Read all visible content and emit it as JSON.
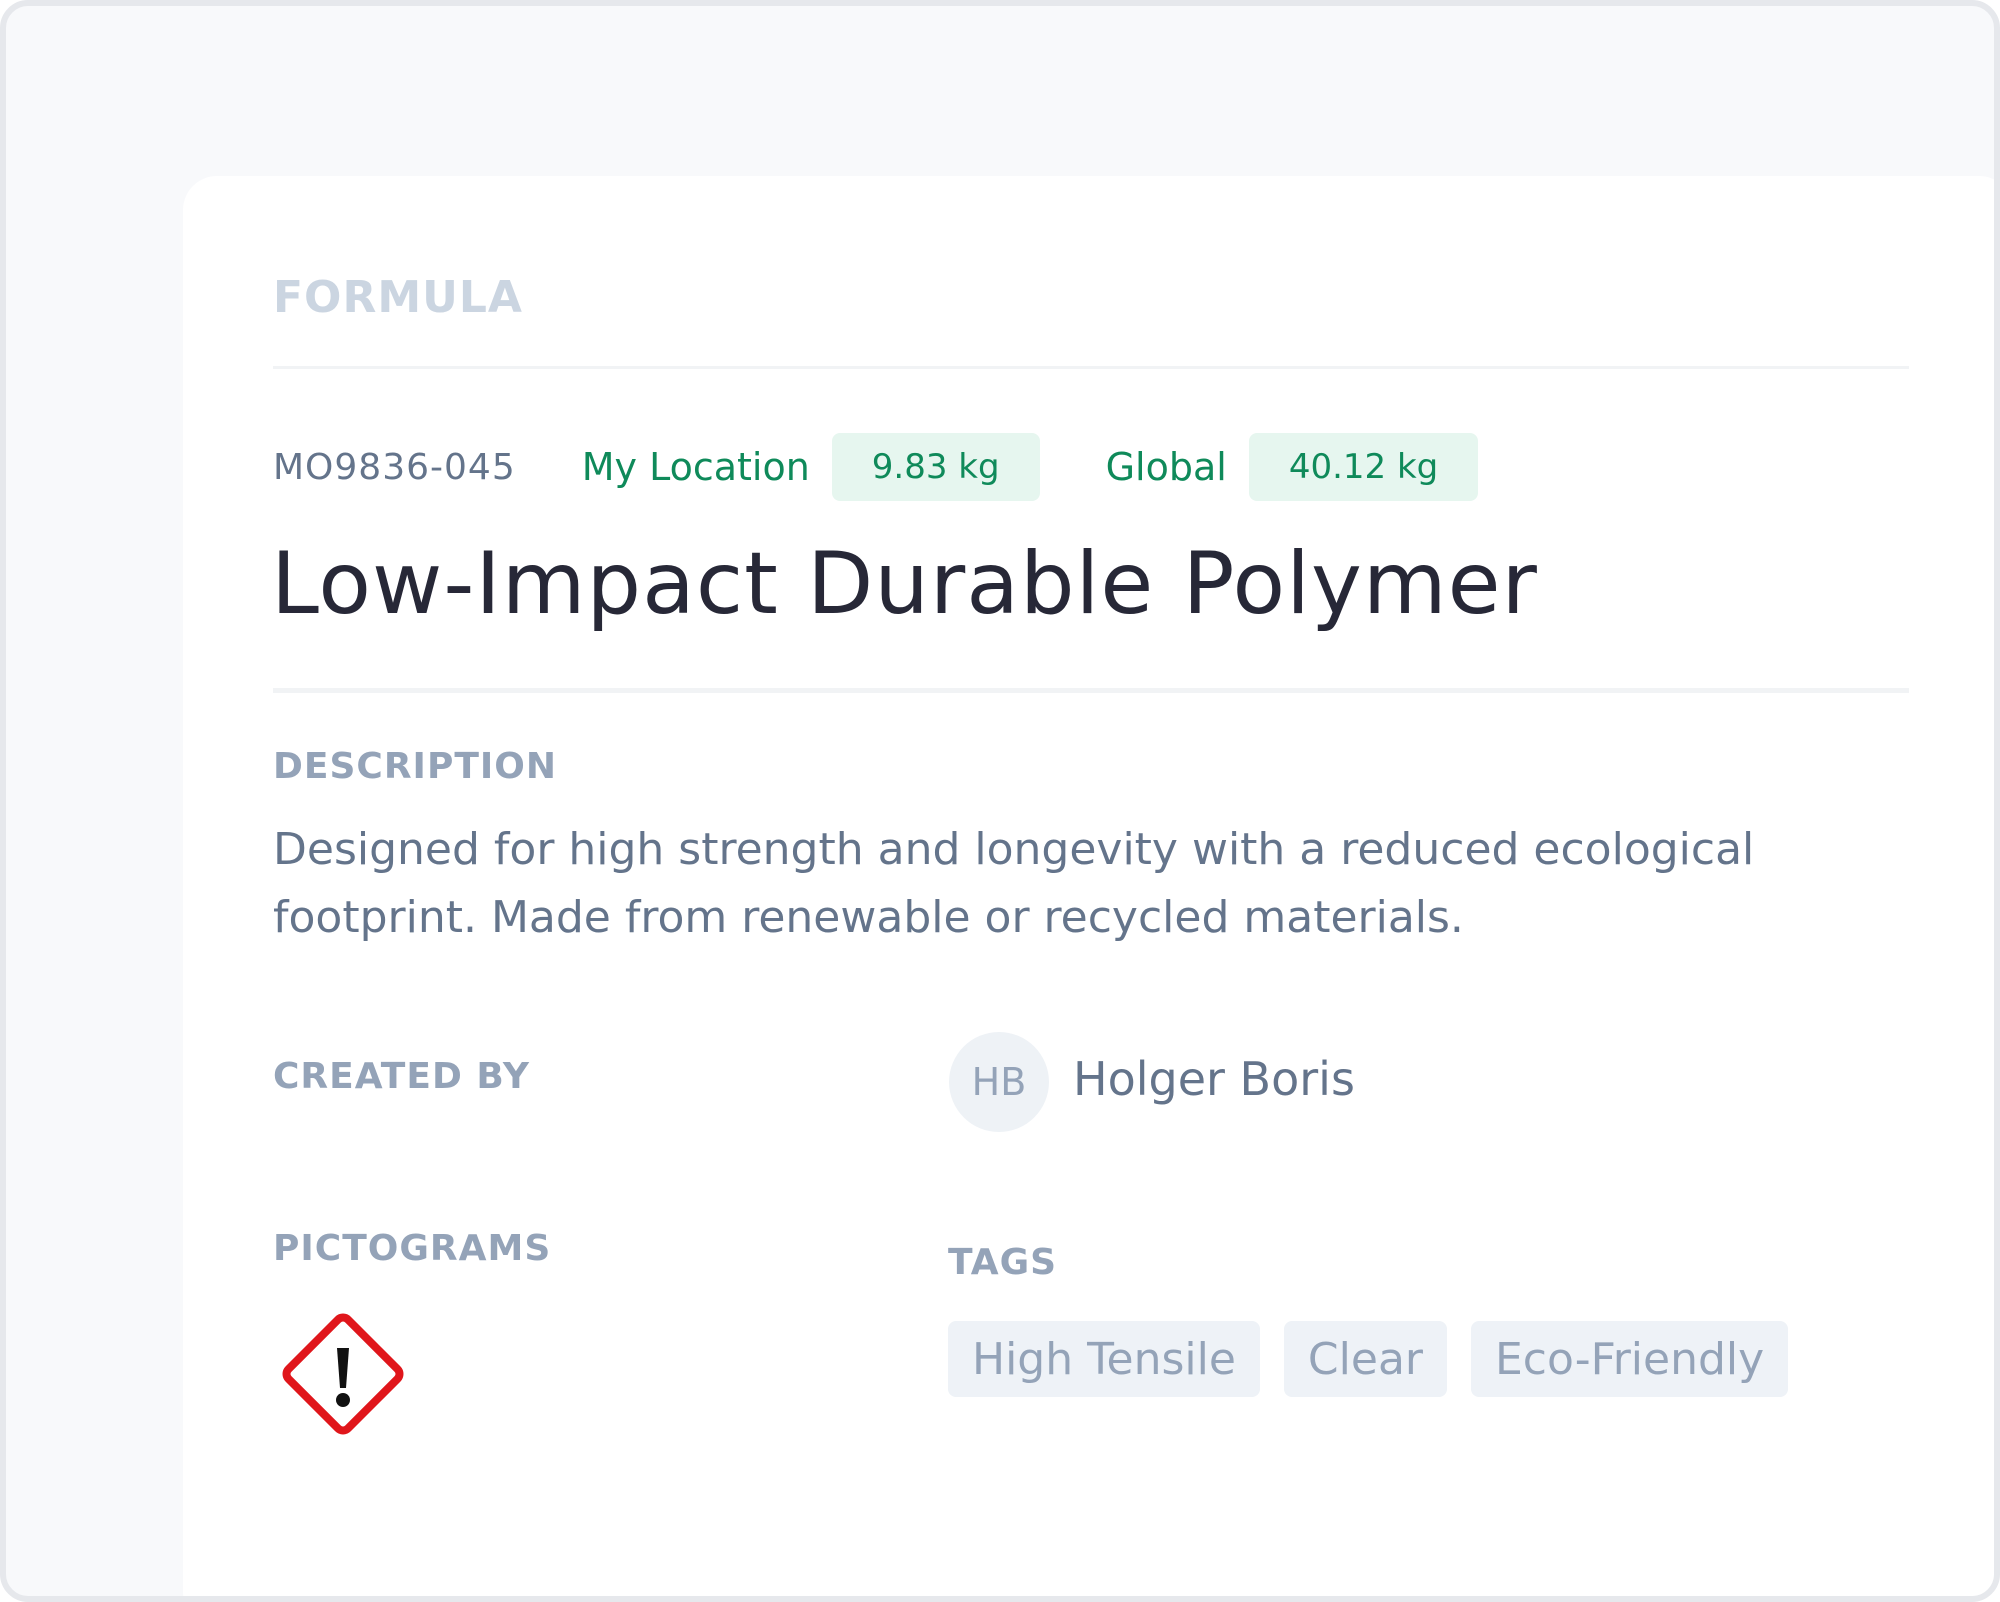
{
  "formula": {
    "section_label": "FORMULA",
    "code": "MO9836-045",
    "my_location_label": "My Location",
    "my_location_value": "9.83 kg",
    "global_label": "Global",
    "global_value": "40.12 kg",
    "title": "Low-Impact Durable Polymer"
  },
  "description": {
    "label": "DESCRIPTION",
    "text": "Designed for high strength and longevity with a reduced ecological footprint. Made from renewable or recycled materials."
  },
  "created_by": {
    "label": "CREATED BY",
    "initials": "HB",
    "name": "Holger Boris"
  },
  "pictograms": {
    "label": "PICTOGRAMS",
    "items": [
      {
        "icon": "exclamation-hazard-icon",
        "color": "#e0161b"
      }
    ]
  },
  "tags": {
    "label": "TAGS",
    "items": [
      "High Tensile",
      "Clear",
      "Eco-Friendly"
    ]
  },
  "colors": {
    "accent_green": "#0f8a5a",
    "accent_green_bg": "#e6f6ef",
    "hazard_red": "#e0161b"
  }
}
